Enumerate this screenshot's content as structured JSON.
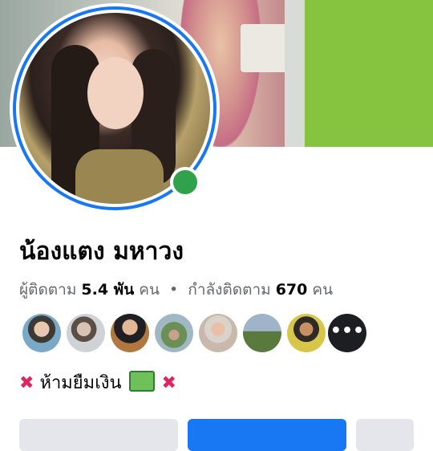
{
  "profile": {
    "name": "น้องแตง มหาวง",
    "stats": {
      "followers_label": "ผู้ติดตาม",
      "followers_count": "5.4 พัน",
      "followers_unit": "คน",
      "separator": "•",
      "following_label": "กำลังติดตาม",
      "following_count": "670",
      "following_unit": "คน"
    },
    "online": true,
    "bio_text": "ห้ามยืมเงิน",
    "more_friends": "•••"
  },
  "colors": {
    "accent_blue": "#1877f2",
    "online_green": "#31a24c",
    "text_primary": "#050505",
    "text_secondary": "#65676b"
  }
}
